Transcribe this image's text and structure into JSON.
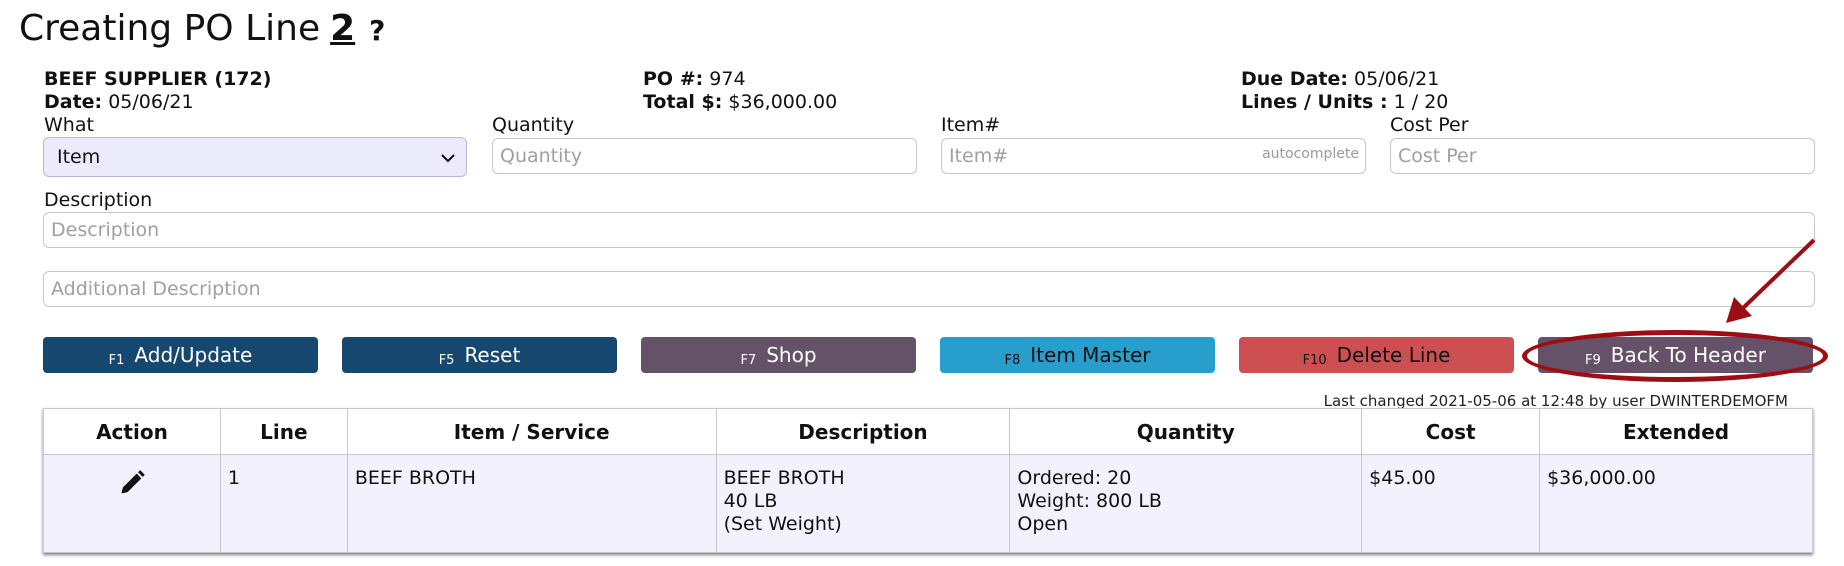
{
  "page": {
    "title": "Creating PO Line",
    "line_number": "2",
    "help": "?"
  },
  "header": {
    "supplier": "BEEF SUPPLIER (172)",
    "date_label": "Date:",
    "date_value": "05/06/21",
    "po_label": "PO #:",
    "po_value": "974",
    "total_label": "Total $:",
    "total_value": "$36,000.00",
    "due_label": "Due Date:",
    "due_value": "05/06/21",
    "lines_label": "Lines / Units :",
    "lines_value": "1 / 20"
  },
  "form": {
    "what_label": "What",
    "what_value": "Item",
    "quantity_label": "Quantity",
    "quantity_placeholder": "Quantity",
    "item_label": "Item#",
    "item_placeholder": "Item#",
    "item_hint": "autocomplete",
    "cost_label": "Cost Per",
    "cost_placeholder": "Cost Per",
    "description_label": "Description",
    "description_placeholder": "Description",
    "additional_placeholder": "Additional Description"
  },
  "buttons": [
    {
      "key": "F1",
      "label": "Add/Update",
      "color": "#15476f"
    },
    {
      "key": "F5",
      "label": "Reset",
      "color": "#15476f"
    },
    {
      "key": "F7",
      "label": "Shop",
      "color": "#655268"
    },
    {
      "key": "F8",
      "label": "Item Master",
      "color": "#279ecb"
    },
    {
      "key": "F10",
      "label": "Delete Line",
      "color": "#cd4f52"
    },
    {
      "key": "F9",
      "label": "Back To Header",
      "color": "#655268"
    }
  ],
  "annotation_color": "#9b0f14",
  "last_changed": "Last changed 2021-05-06 at 12:48 by user DWINTERDEMOFM",
  "table": {
    "columns": [
      "Action",
      "Line",
      "Item / Service",
      "Description",
      "Quantity",
      "Cost",
      "Extended"
    ],
    "rows": [
      {
        "action_icon": "pencil-icon",
        "line": "1",
        "item": "BEEF BROTH",
        "desc1": "BEEF BROTH",
        "desc2": "40 LB",
        "desc3": "(Set Weight)",
        "qty1": "Ordered: 20",
        "qty2": "Weight: 800 LB",
        "qty3": "Open",
        "cost": "$45.00",
        "extended": "$36,000.00"
      }
    ]
  }
}
